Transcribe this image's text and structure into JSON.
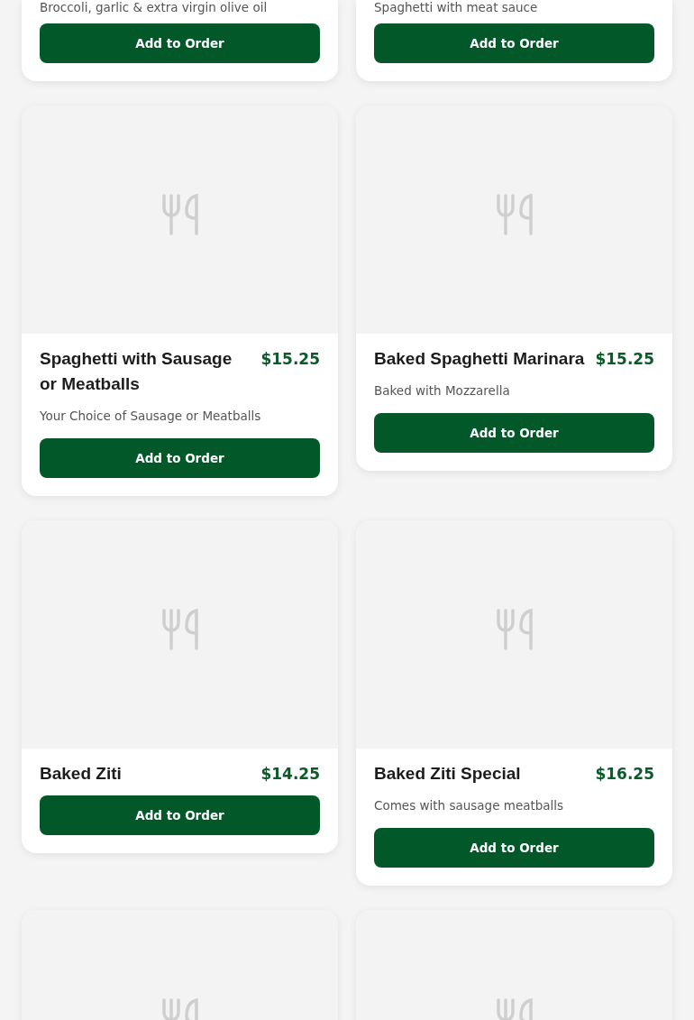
{
  "menu_items": [
    {
      "kind": "partial",
      "description": "Broccoli, garlic & extra virgin olive oil",
      "button": "Add to Order"
    },
    {
      "kind": "partial",
      "description": "Spaghetti with meat sauce",
      "button": "Add to Order"
    },
    {
      "kind": "full",
      "name": "Spaghetti with Sausage or Meatballs",
      "price": "$15.25",
      "description": "Your Choice of Sausage or Meatballs",
      "button": "Add to Order"
    },
    {
      "kind": "full",
      "name": "Baked Spaghetti Marinara",
      "price": "$15.25",
      "description": "Baked with Mozzarella",
      "button": "Add to Order"
    },
    {
      "kind": "full",
      "name": "Baked Ziti",
      "price": "$14.25",
      "button": "Add to Order"
    },
    {
      "kind": "full",
      "name": "Baked Ziti Special",
      "price": "$16.25",
      "description": "Comes with sausage meatballs",
      "button": "Add to Order"
    },
    {
      "kind": "image_only"
    },
    {
      "kind": "image_only"
    }
  ]
}
